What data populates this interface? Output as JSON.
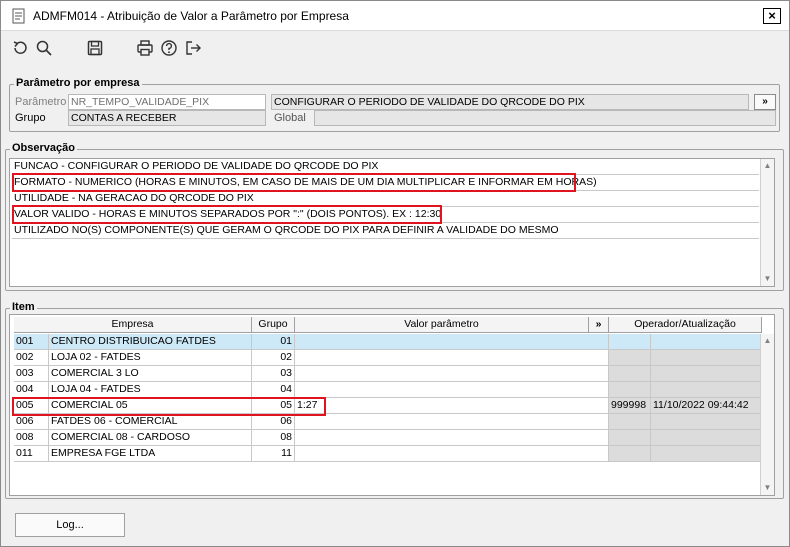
{
  "window": {
    "title": "ADMFM014 - Atribuição de Valor a Parâmetro por Empresa",
    "close": "×"
  },
  "toolbar": {
    "icons": [
      "undo-icon",
      "search-icon",
      "save-icon",
      "print-icon",
      "help-icon",
      "exit-icon"
    ]
  },
  "param": {
    "group_title": "Parâmetro por empresa",
    "param_label": "Parâmetro",
    "param_value": "NR_TEMPO_VALIDADE_PIX",
    "param_desc": "CONFIGURAR O PERIODO DE VALIDADE DO QRCODE DO PIX",
    "group_label": "Grupo",
    "group_value": "CONTAS A RECEBER",
    "global_label": "Global",
    "global_value": "",
    "more_label": "»"
  },
  "obs": {
    "title": "Observação",
    "lines": [
      "FUNCAO - CONFIGURAR O PERIODO DE VALIDADE DO QRCODE DO PIX",
      "FORMATO - NUMERICO (HORAS E MINUTOS, EM CASO DE MAIS DE UM DIA MULTIPLICAR E INFORMAR EM HORAS)",
      "UTILIDADE - NA GERACAO DO QRCODE DO PIX",
      "VALOR VALIDO - HORAS E MINUTOS SEPARADOS POR \":\" (DOIS PONTOS). EX : 12:30",
      "UTILIZADO NO(S) COMPONENTE(S) QUE GERAM O QRCODE DO PIX PARA DEFINIR A VALIDADE DO MESMO"
    ]
  },
  "item": {
    "title": "Item",
    "headers": {
      "empresa": "Empresa",
      "grupo": "Grupo",
      "valor": "Valor parâmetro",
      "more": "»",
      "operador": "Operador/Atualização"
    },
    "rows": [
      {
        "code": "001",
        "name": "CENTRO DISTRIBUICAO FATDES",
        "grupo": "01",
        "valor": "",
        "op": "",
        "data": ""
      },
      {
        "code": "002",
        "name": "LOJA 02 - FATDES",
        "grupo": "02",
        "valor": "",
        "op": "",
        "data": ""
      },
      {
        "code": "003",
        "name": "COMERCIAL 3 LO",
        "grupo": "03",
        "valor": "",
        "op": "",
        "data": ""
      },
      {
        "code": "004",
        "name": "LOJA 04 - FATDES",
        "grupo": "04",
        "valor": "",
        "op": "",
        "data": ""
      },
      {
        "code": "005",
        "name": "COMERCIAL 05",
        "grupo": "05",
        "valor": "1:27",
        "op": "999998",
        "data": "11/10/2022 09:44:42"
      },
      {
        "code": "006",
        "name": "FATDES 06 - COMERCIAL",
        "grupo": "06",
        "valor": "",
        "op": "",
        "data": ""
      },
      {
        "code": "008",
        "name": "COMERCIAL 08 - CARDOSO",
        "grupo": "08",
        "valor": "",
        "op": "",
        "data": ""
      },
      {
        "code": "011",
        "name": "EMPRESA FGE LTDA",
        "grupo": "11",
        "valor": "",
        "op": "",
        "data": ""
      }
    ]
  },
  "footer": {
    "log_label": "Log..."
  },
  "colors": {
    "highlight": "#e0141e",
    "selected_row": "#cde8f7",
    "readonly_cell": "#dcdcdc"
  }
}
